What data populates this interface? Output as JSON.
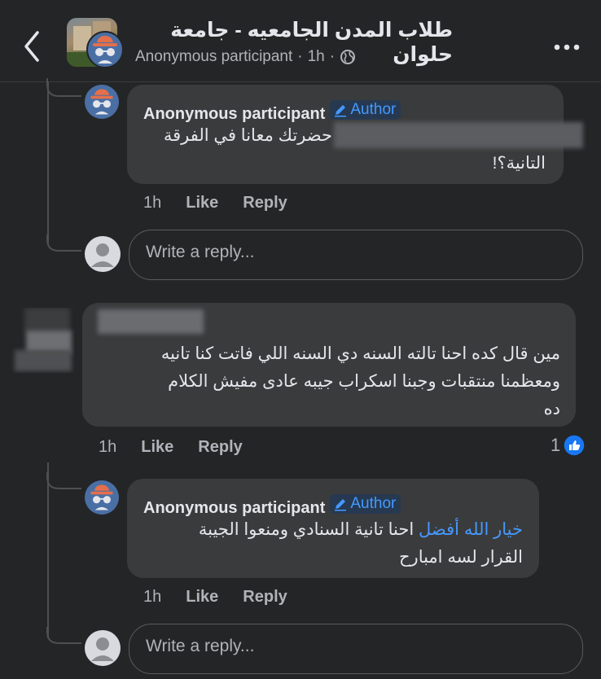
{
  "header": {
    "group_name": "طلاب المدن الجامعيه - جامعة حلوان",
    "poster": "Anonymous participant",
    "time": "1h",
    "sep": "·"
  },
  "threads": {
    "c1": {
      "author": "Anonymous participant",
      "badge": "Author",
      "text_line1": "حضرتك معانا في الفرقة",
      "text_line2": "التانية؟!",
      "time": "1h",
      "like": "Like",
      "reply": "Reply"
    },
    "reply_box_1": {
      "placeholder": "Write a reply..."
    },
    "c2": {
      "line1": "مين قال كده احنا تالته السنه دي السنه اللي فاتت كنا تانيه",
      "line2": "ومعظمنا منتقبات وجبنا اسكراب جيبه عادى مفيش الكلام",
      "line3": "ده",
      "time": "1h",
      "like": "Like",
      "reply": "Reply",
      "reaction_count": "1"
    },
    "c3": {
      "author": "Anonymous participant",
      "badge": "Author",
      "mention": "خيار الله أفضل",
      "text_line1_rest": " احنا تانية السنادي ومنعوا الجيبة",
      "text_line2": "القرار لسه امبارح",
      "time": "1h",
      "like": "Like",
      "reply": "Reply"
    },
    "reply_box_2": {
      "placeholder": "Write a reply..."
    }
  },
  "colors": {
    "background": "#242526",
    "bubble": "#3a3b3c",
    "accent": "#4599ff",
    "muted": "#b0b3b8",
    "avatar": "#4a6fa5"
  },
  "icons": [
    "back-chevron-icon",
    "anonymous-icon",
    "globe-icon",
    "more-dots-icon",
    "pencil-icon",
    "like-reaction-icon",
    "default-avatar-icon"
  ]
}
